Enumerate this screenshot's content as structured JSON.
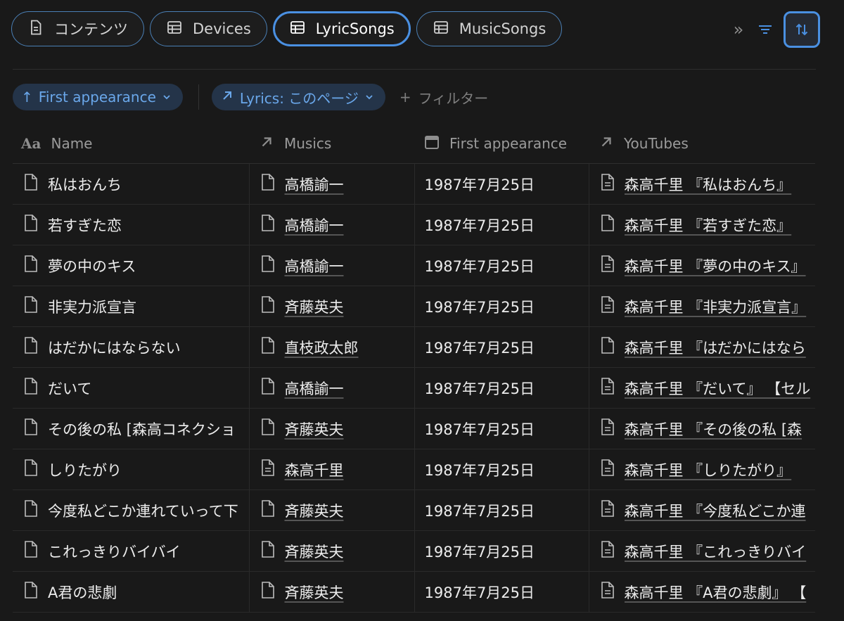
{
  "tabs": [
    {
      "label": "コンテンツ",
      "icon": "page-icon"
    },
    {
      "label": "Devices",
      "icon": "table-icon"
    },
    {
      "label": "LyricSongs",
      "icon": "table-icon"
    },
    {
      "label": "MusicSongs",
      "icon": "table-icon"
    }
  ],
  "toolbar": {
    "more": "»",
    "filter_icon": "filter-icon",
    "sort_icon": "sort-icon"
  },
  "filters": {
    "sort_pill": "First appearance",
    "lyrics_pill": "Lyrics: このページ",
    "add_filter": "フィルター",
    "add_glyph": "+",
    "sort_arrow": "↑",
    "chevron": "⌄"
  },
  "columns": {
    "name": "Name",
    "name_prefix": "Aa",
    "musics": "Musics",
    "first": "First appearance",
    "youtubes": "YouTubes"
  },
  "rows": [
    {
      "name": "私はおんち",
      "music": "高橋諭一",
      "date": "1987年7月25日",
      "yt": "森高千里 『私はおんち』"
    },
    {
      "name": "若すぎた恋",
      "music": "高橋諭一",
      "date": "1987年7月25日",
      "yt": "森高千里 『若すぎた恋』"
    },
    {
      "name": "夢の中のキス",
      "music": "高橋諭一",
      "date": "1987年7月25日",
      "yt": "森高千里 『夢の中のキス』"
    },
    {
      "name": "非実力派宣言",
      "music": "斉藤英夫",
      "date": "1987年7月25日",
      "yt": "森高千里 『非実力派宣言』"
    },
    {
      "name": "はだかにはならない",
      "music": "直枝政太郎",
      "date": "1987年7月25日",
      "yt": "森高千里 『はだかにはなら"
    },
    {
      "name": "だいて",
      "music": "高橋諭一",
      "date": "1987年7月25日",
      "yt": "森高千里 『だいて』 【セル"
    },
    {
      "name": "その後の私 [森高コネクショ",
      "music": "斉藤英夫",
      "date": "1987年7月25日",
      "yt": "森高千里 『その後の私 [森"
    },
    {
      "name": "しりたがり",
      "music": "森高千里",
      "date": "1987年7月25日",
      "yt": "森高千里 『しりたがり』"
    },
    {
      "name": "今度私どこか連れていって下",
      "music": "斉藤英夫",
      "date": "1987年7月25日",
      "yt": "森高千里 『今度私どこか連"
    },
    {
      "name": "これっきりバイバイ",
      "music": "斉藤英夫",
      "date": "1987年7月25日",
      "yt": "森高千里 『これっきりバイ"
    },
    {
      "name": "A君の悲劇",
      "music": "斉藤英夫",
      "date": "1987年7月25日",
      "yt": "森高千里 『A君の悲劇』 【"
    }
  ]
}
